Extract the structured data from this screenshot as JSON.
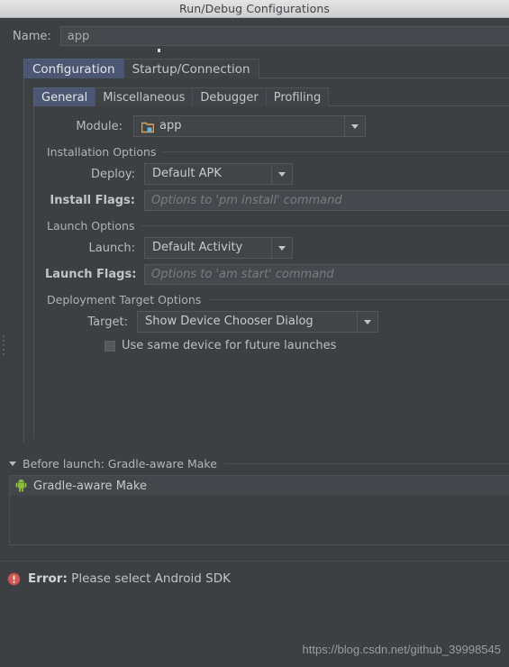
{
  "window": {
    "title": "Run/Debug Configurations"
  },
  "name_field": {
    "label": "Name:",
    "value": "app",
    "placeholder": ""
  },
  "outer_tabs": [
    {
      "label": "Configuration",
      "selected": true
    },
    {
      "label": "Startup/Connection",
      "selected": false
    }
  ],
  "inner_tabs": [
    {
      "label": "General",
      "selected": true
    },
    {
      "label": "Miscellaneous",
      "selected": false
    },
    {
      "label": "Debugger",
      "selected": false
    },
    {
      "label": "Profiling",
      "selected": false
    }
  ],
  "module_row": {
    "label": "Module:",
    "value": "app",
    "icon": "module-folder-icon"
  },
  "installation_options": {
    "title": "Installation Options",
    "deploy": {
      "label": "Deploy:",
      "value": "Default APK"
    },
    "install_flags": {
      "label": "Install Flags:",
      "value": "",
      "placeholder": "Options to 'pm install' command"
    }
  },
  "launch_options": {
    "title": "Launch Options",
    "launch": {
      "label": "Launch:",
      "value": "Default Activity"
    },
    "launch_flags": {
      "label": "Launch Flags:",
      "value": "",
      "placeholder": "Options to 'am start' command"
    }
  },
  "deployment_target_options": {
    "title": "Deployment Target Options",
    "target": {
      "label": "Target:",
      "value": "Show Device Chooser Dialog"
    },
    "use_same_device": {
      "label": "Use same device for future launches",
      "checked": false
    }
  },
  "before_launch": {
    "title": "Before launch: Gradle-aware Make",
    "items": [
      {
        "label": "Gradle-aware Make",
        "icon": "android-icon"
      }
    ]
  },
  "status": {
    "prefix": "Error:",
    "message": "Please select Android SDK",
    "icon": "error-icon"
  },
  "watermark": {
    "text": "https://blog.csdn.net/github_39998545"
  },
  "colors": {
    "background": "#3c4043",
    "tab_selected": "#4b5772",
    "error_red": "#cf5b56",
    "android_green": "#8fbf3f",
    "folder_orange": "#d9a martens"
  }
}
